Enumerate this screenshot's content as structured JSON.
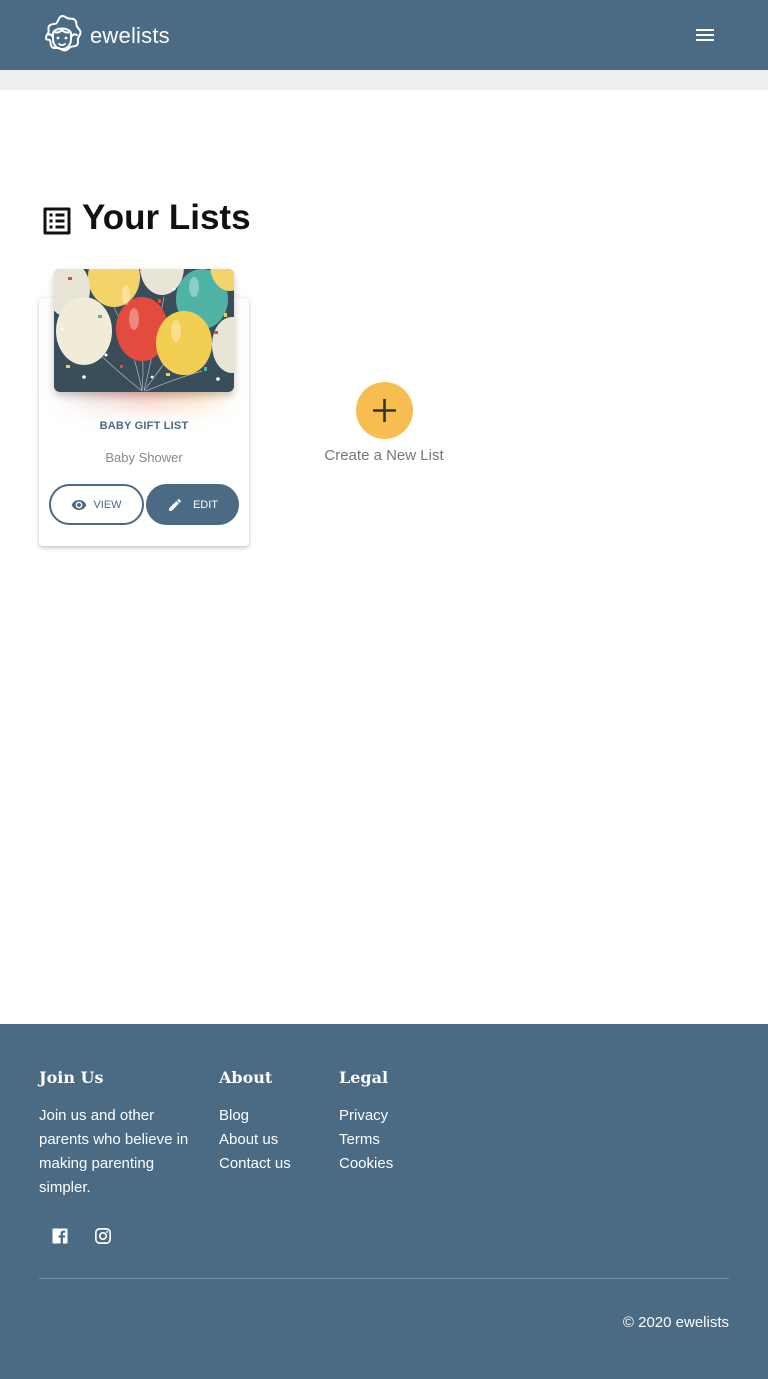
{
  "header": {
    "brand_name": "ewelists",
    "logo_icon": "sheep-logo-icon",
    "menu_icon": "hamburger-menu-icon"
  },
  "main": {
    "title": "Your Lists",
    "title_icon": "list-alt-icon",
    "lists": [
      {
        "category": "BABY GIFT LIST",
        "subtitle": "Baby Shower",
        "image": "balloons-image",
        "view_label": "VIEW",
        "view_icon": "eye-icon",
        "edit_label": "EDIT",
        "edit_icon": "pencil-icon"
      }
    ],
    "create": {
      "label": "Create a New List",
      "icon": "plus-icon"
    }
  },
  "footer": {
    "join": {
      "title": "Join Us",
      "text": "Join us and other parents who believe in making parenting simpler."
    },
    "about": {
      "title": "About",
      "links": [
        "Blog",
        "About us",
        "Contact us"
      ]
    },
    "legal": {
      "title": "Legal",
      "links": [
        "Privacy",
        "Terms",
        "Cookies"
      ]
    },
    "social": [
      "facebook-icon",
      "instagram-icon"
    ],
    "copyright": "© 2020 ewelists"
  },
  "colors": {
    "primary": "#4b6a84",
    "accent": "#f7bd51",
    "background": "#ffffff"
  }
}
